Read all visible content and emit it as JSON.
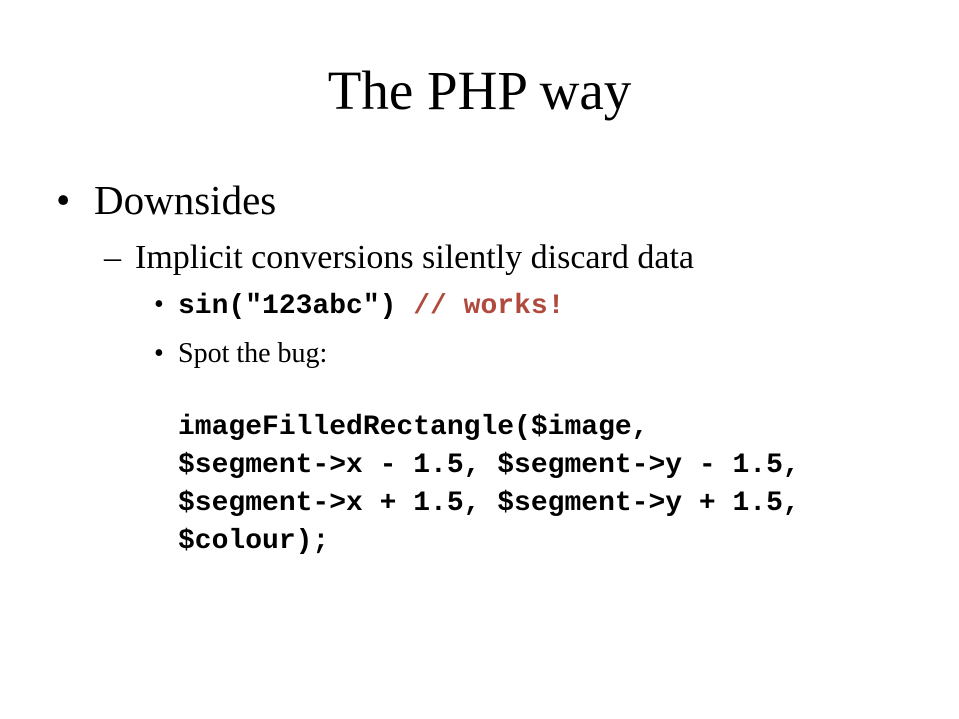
{
  "slide": {
    "title": "The PHP way",
    "bullet_symbol": "•",
    "dash_symbol": "–",
    "level1": {
      "text": "Downsides"
    },
    "level2": {
      "text": "Implicit conversions silently discard data"
    },
    "item_sin": {
      "code": "sin(\"123abc\")",
      "comment": "// works!"
    },
    "item_spot": {
      "text": "Spot the bug:"
    },
    "code_lines": [
      "imageFilledRectangle($image,",
      "$segment->x - 1.5, $segment->y - 1.5,",
      "$segment->x + 1.5, $segment->y + 1.5,",
      "$colour);"
    ],
    "colors": {
      "background": "#ffffff",
      "text": "#000000",
      "comment": "#b04a3e"
    }
  }
}
